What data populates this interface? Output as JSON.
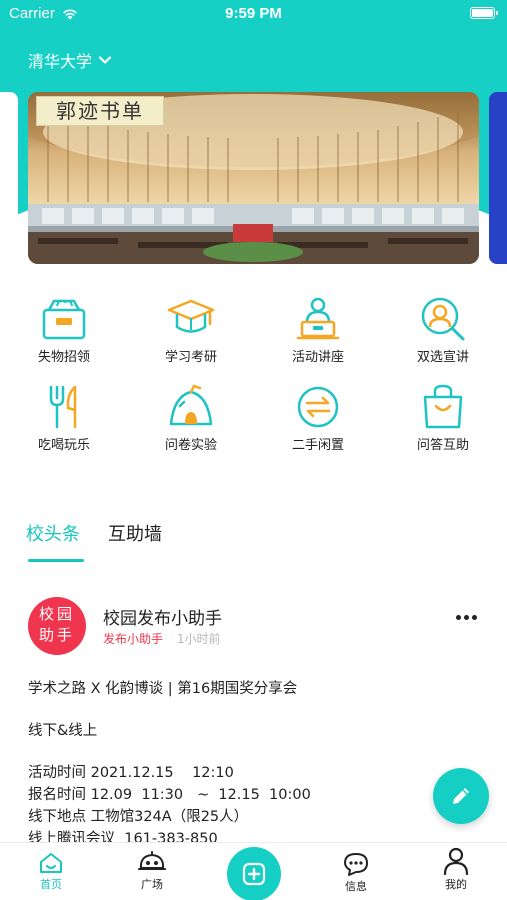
{
  "status_bar": {
    "carrier": "Carrier",
    "time": "9:59 PM"
  },
  "header": {
    "school": "清华大学"
  },
  "banner": {
    "stamp_text": "郭迹书单"
  },
  "categories": [
    {
      "label": "失物招领",
      "icon": "lost-found-icon"
    },
    {
      "label": "学习考研",
      "icon": "graduation-cap-icon"
    },
    {
      "label": "活动讲座",
      "icon": "lecture-icon"
    },
    {
      "label": "双选宣讲",
      "icon": "recruit-search-icon"
    },
    {
      "label": "吃喝玩乐",
      "icon": "fork-knife-icon"
    },
    {
      "label": "问卷实验",
      "icon": "survey-tent-icon"
    },
    {
      "label": "二手闲置",
      "icon": "exchange-icon"
    },
    {
      "label": "问答互助",
      "icon": "shopping-bag-icon"
    }
  ],
  "tabs": [
    {
      "label": "校头条",
      "active": true
    },
    {
      "label": "互助墙",
      "active": false
    }
  ],
  "post": {
    "avatar_line1": "校园",
    "avatar_line2": "助手",
    "author": "校园发布小助手",
    "source": "发布小助手",
    "time": "1小时前",
    "lines": [
      "学术之路 X 化韵博谈 | 第16期国奖分享会",
      "线下&线上",
      "活动时间 2021.12.15    12:10",
      "报名时间 12.09  11:30   ~  12.15  10:00",
      "线下地点 工物馆324A（限25人）",
      "线上腾讯会议  161-383-850"
    ]
  },
  "bottom_nav": [
    {
      "label": "首页",
      "icon": "home-icon",
      "active": true
    },
    {
      "label": "广场",
      "icon": "plaza-icon",
      "active": false
    },
    {
      "label": "",
      "icon": "add-icon",
      "active": false
    },
    {
      "label": "信息",
      "icon": "message-icon",
      "active": false
    },
    {
      "label": "我的",
      "icon": "profile-icon",
      "active": false
    }
  ],
  "colors": {
    "accent": "#16cfc4",
    "icon_teal": "#1fc3c4",
    "icon_orange": "#f5a623",
    "avatar_red": "#f0364f",
    "banner_right": "#2842c6"
  }
}
